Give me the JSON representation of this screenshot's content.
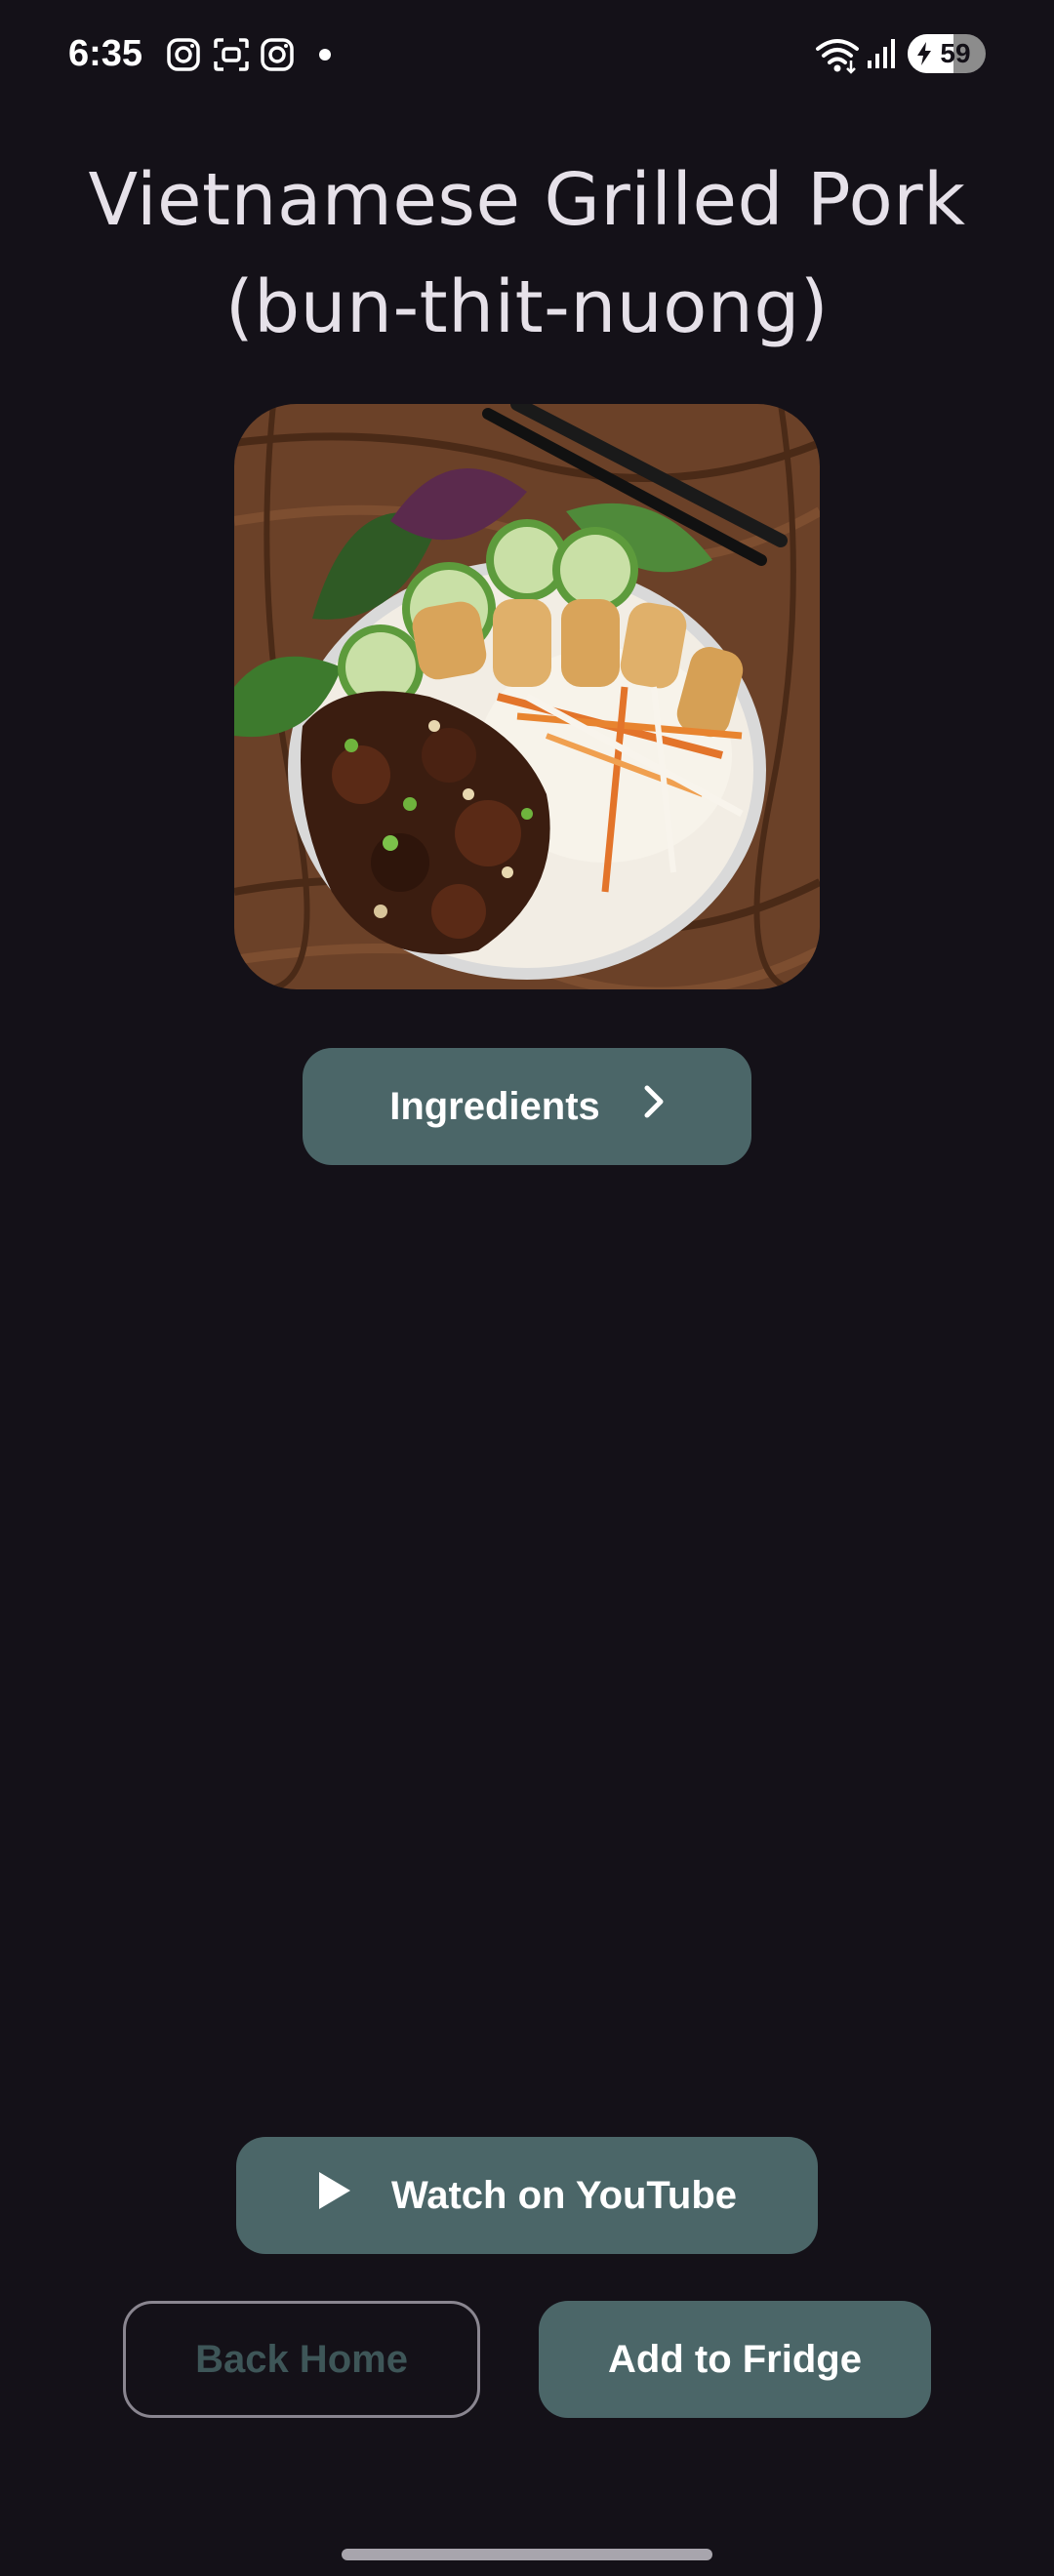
{
  "status_bar": {
    "time": "6:35",
    "battery_level": "59",
    "battery_fraction": 0.59,
    "icons": [
      "instagram-icon",
      "scan-icon",
      "instagram-icon",
      "notification-dot",
      "wifi-icon",
      "signal-icon",
      "battery-charging-icon"
    ]
  },
  "recipe": {
    "title": "Vietnamese Grilled Pork (bun-thit-nuong)",
    "image_alt": "Bowl of grilled pork with noodles, cucumber, herbs, carrots and spring rolls"
  },
  "buttons": {
    "ingredients_label": "Ingredients",
    "youtube_label": "Watch on YouTube",
    "back_home_label": "Back Home",
    "add_to_fridge_label": "Add to Fridge"
  },
  "colors": {
    "background": "#141118",
    "button_fill": "#4b6668",
    "title_text": "#e6e1e9",
    "outline_text": "#3e5658"
  }
}
